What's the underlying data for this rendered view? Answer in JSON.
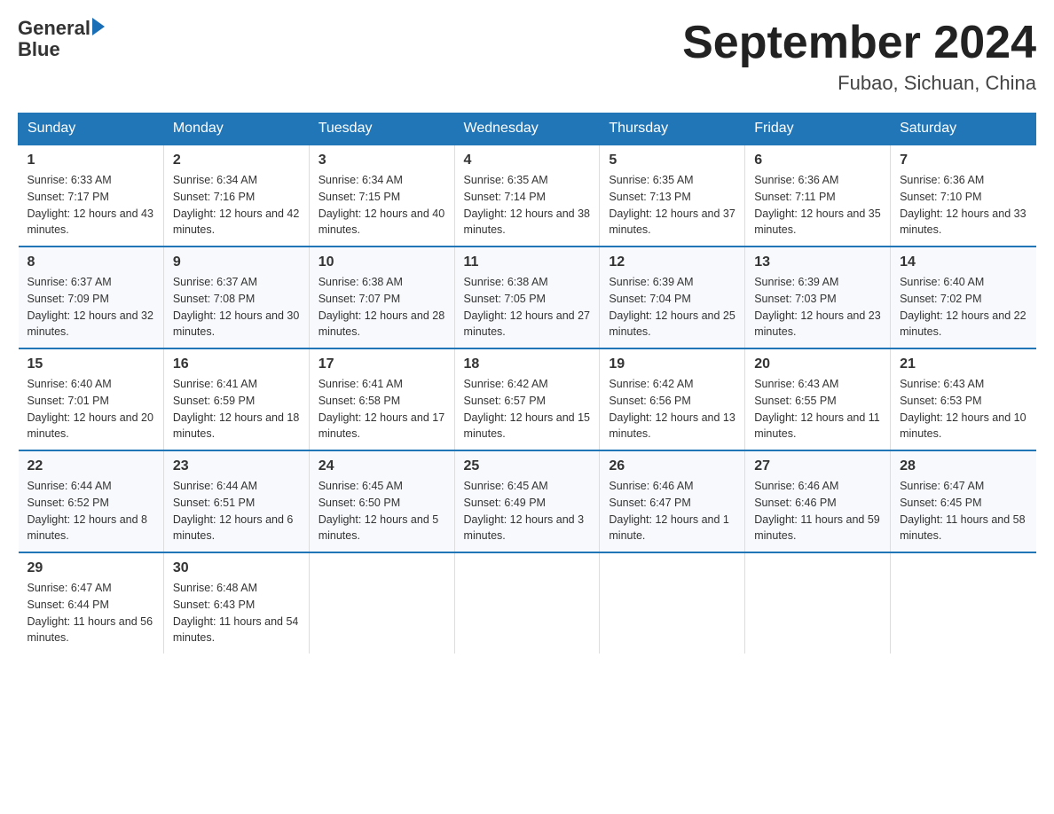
{
  "header": {
    "logo": {
      "line1": "General",
      "arrow": "▶",
      "line2": "Blue"
    },
    "title": "September 2024",
    "location": "Fubao, Sichuan, China"
  },
  "days_of_week": [
    "Sunday",
    "Monday",
    "Tuesday",
    "Wednesday",
    "Thursday",
    "Friday",
    "Saturday"
  ],
  "weeks": [
    [
      {
        "day": "1",
        "sunrise": "Sunrise: 6:33 AM",
        "sunset": "Sunset: 7:17 PM",
        "daylight": "Daylight: 12 hours and 43 minutes."
      },
      {
        "day": "2",
        "sunrise": "Sunrise: 6:34 AM",
        "sunset": "Sunset: 7:16 PM",
        "daylight": "Daylight: 12 hours and 42 minutes."
      },
      {
        "day": "3",
        "sunrise": "Sunrise: 6:34 AM",
        "sunset": "Sunset: 7:15 PM",
        "daylight": "Daylight: 12 hours and 40 minutes."
      },
      {
        "day": "4",
        "sunrise": "Sunrise: 6:35 AM",
        "sunset": "Sunset: 7:14 PM",
        "daylight": "Daylight: 12 hours and 38 minutes."
      },
      {
        "day": "5",
        "sunrise": "Sunrise: 6:35 AM",
        "sunset": "Sunset: 7:13 PM",
        "daylight": "Daylight: 12 hours and 37 minutes."
      },
      {
        "day": "6",
        "sunrise": "Sunrise: 6:36 AM",
        "sunset": "Sunset: 7:11 PM",
        "daylight": "Daylight: 12 hours and 35 minutes."
      },
      {
        "day": "7",
        "sunrise": "Sunrise: 6:36 AM",
        "sunset": "Sunset: 7:10 PM",
        "daylight": "Daylight: 12 hours and 33 minutes."
      }
    ],
    [
      {
        "day": "8",
        "sunrise": "Sunrise: 6:37 AM",
        "sunset": "Sunset: 7:09 PM",
        "daylight": "Daylight: 12 hours and 32 minutes."
      },
      {
        "day": "9",
        "sunrise": "Sunrise: 6:37 AM",
        "sunset": "Sunset: 7:08 PM",
        "daylight": "Daylight: 12 hours and 30 minutes."
      },
      {
        "day": "10",
        "sunrise": "Sunrise: 6:38 AM",
        "sunset": "Sunset: 7:07 PM",
        "daylight": "Daylight: 12 hours and 28 minutes."
      },
      {
        "day": "11",
        "sunrise": "Sunrise: 6:38 AM",
        "sunset": "Sunset: 7:05 PM",
        "daylight": "Daylight: 12 hours and 27 minutes."
      },
      {
        "day": "12",
        "sunrise": "Sunrise: 6:39 AM",
        "sunset": "Sunset: 7:04 PM",
        "daylight": "Daylight: 12 hours and 25 minutes."
      },
      {
        "day": "13",
        "sunrise": "Sunrise: 6:39 AM",
        "sunset": "Sunset: 7:03 PM",
        "daylight": "Daylight: 12 hours and 23 minutes."
      },
      {
        "day": "14",
        "sunrise": "Sunrise: 6:40 AM",
        "sunset": "Sunset: 7:02 PM",
        "daylight": "Daylight: 12 hours and 22 minutes."
      }
    ],
    [
      {
        "day": "15",
        "sunrise": "Sunrise: 6:40 AM",
        "sunset": "Sunset: 7:01 PM",
        "daylight": "Daylight: 12 hours and 20 minutes."
      },
      {
        "day": "16",
        "sunrise": "Sunrise: 6:41 AM",
        "sunset": "Sunset: 6:59 PM",
        "daylight": "Daylight: 12 hours and 18 minutes."
      },
      {
        "day": "17",
        "sunrise": "Sunrise: 6:41 AM",
        "sunset": "Sunset: 6:58 PM",
        "daylight": "Daylight: 12 hours and 17 minutes."
      },
      {
        "day": "18",
        "sunrise": "Sunrise: 6:42 AM",
        "sunset": "Sunset: 6:57 PM",
        "daylight": "Daylight: 12 hours and 15 minutes."
      },
      {
        "day": "19",
        "sunrise": "Sunrise: 6:42 AM",
        "sunset": "Sunset: 6:56 PM",
        "daylight": "Daylight: 12 hours and 13 minutes."
      },
      {
        "day": "20",
        "sunrise": "Sunrise: 6:43 AM",
        "sunset": "Sunset: 6:55 PM",
        "daylight": "Daylight: 12 hours and 11 minutes."
      },
      {
        "day": "21",
        "sunrise": "Sunrise: 6:43 AM",
        "sunset": "Sunset: 6:53 PM",
        "daylight": "Daylight: 12 hours and 10 minutes."
      }
    ],
    [
      {
        "day": "22",
        "sunrise": "Sunrise: 6:44 AM",
        "sunset": "Sunset: 6:52 PM",
        "daylight": "Daylight: 12 hours and 8 minutes."
      },
      {
        "day": "23",
        "sunrise": "Sunrise: 6:44 AM",
        "sunset": "Sunset: 6:51 PM",
        "daylight": "Daylight: 12 hours and 6 minutes."
      },
      {
        "day": "24",
        "sunrise": "Sunrise: 6:45 AM",
        "sunset": "Sunset: 6:50 PM",
        "daylight": "Daylight: 12 hours and 5 minutes."
      },
      {
        "day": "25",
        "sunrise": "Sunrise: 6:45 AM",
        "sunset": "Sunset: 6:49 PM",
        "daylight": "Daylight: 12 hours and 3 minutes."
      },
      {
        "day": "26",
        "sunrise": "Sunrise: 6:46 AM",
        "sunset": "Sunset: 6:47 PM",
        "daylight": "Daylight: 12 hours and 1 minute."
      },
      {
        "day": "27",
        "sunrise": "Sunrise: 6:46 AM",
        "sunset": "Sunset: 6:46 PM",
        "daylight": "Daylight: 11 hours and 59 minutes."
      },
      {
        "day": "28",
        "sunrise": "Sunrise: 6:47 AM",
        "sunset": "Sunset: 6:45 PM",
        "daylight": "Daylight: 11 hours and 58 minutes."
      }
    ],
    [
      {
        "day": "29",
        "sunrise": "Sunrise: 6:47 AM",
        "sunset": "Sunset: 6:44 PM",
        "daylight": "Daylight: 11 hours and 56 minutes."
      },
      {
        "day": "30",
        "sunrise": "Sunrise: 6:48 AM",
        "sunset": "Sunset: 6:43 PM",
        "daylight": "Daylight: 11 hours and 54 minutes."
      },
      {
        "day": "",
        "sunrise": "",
        "sunset": "",
        "daylight": ""
      },
      {
        "day": "",
        "sunrise": "",
        "sunset": "",
        "daylight": ""
      },
      {
        "day": "",
        "sunrise": "",
        "sunset": "",
        "daylight": ""
      },
      {
        "day": "",
        "sunrise": "",
        "sunset": "",
        "daylight": ""
      },
      {
        "day": "",
        "sunrise": "",
        "sunset": "",
        "daylight": ""
      }
    ]
  ]
}
